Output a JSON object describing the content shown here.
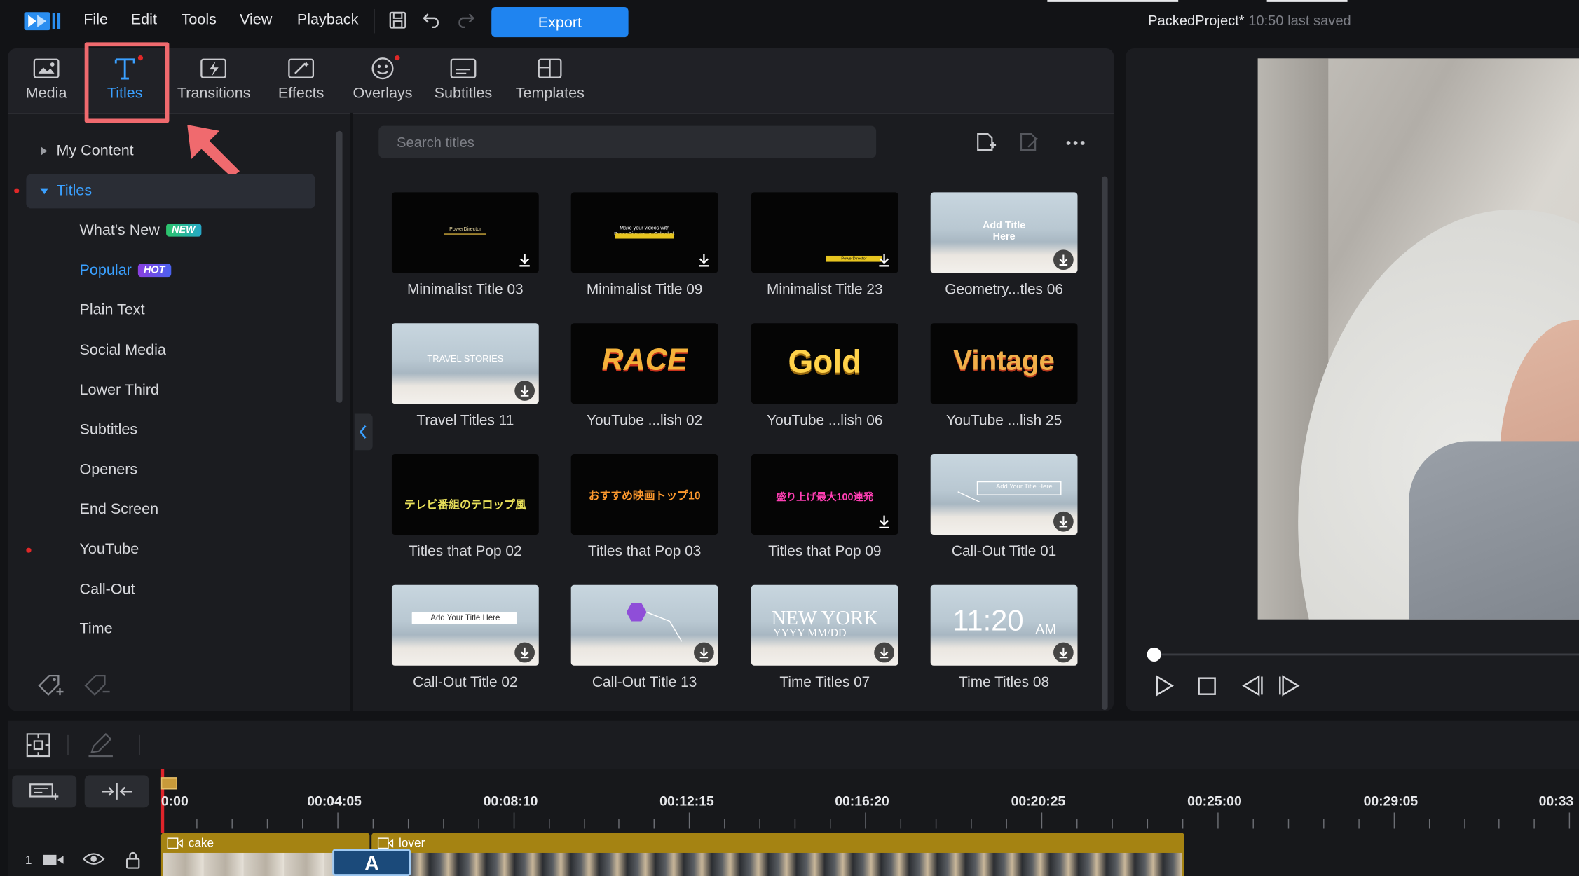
{
  "menu": {
    "file": "File",
    "edit": "Edit",
    "tools": "Tools",
    "view": "View",
    "playback": "Playback",
    "export": "Export"
  },
  "project": {
    "name": "PackedProject*",
    "saved": "10:50 last saved"
  },
  "tabs": [
    {
      "label": "Media",
      "icon": "media-icon"
    },
    {
      "label": "Titles",
      "icon": "titles-icon",
      "active": true
    },
    {
      "label": "Transitions",
      "icon": "transitions-icon"
    },
    {
      "label": "Effects",
      "icon": "effects-icon"
    },
    {
      "label": "Overlays",
      "icon": "overlays-icon"
    },
    {
      "label": "Subtitles",
      "icon": "subtitles-icon"
    },
    {
      "label": "Templates",
      "icon": "templates-icon"
    }
  ],
  "sidebar": {
    "my_content": "My Content",
    "titles": "Titles",
    "items": [
      {
        "label": "What's New",
        "badge": "NEW"
      },
      {
        "label": "Popular",
        "badge": "HOT"
      },
      {
        "label": "Plain Text"
      },
      {
        "label": "Social Media"
      },
      {
        "label": "Lower Third"
      },
      {
        "label": "Subtitles"
      },
      {
        "label": "Openers"
      },
      {
        "label": "End Screen"
      },
      {
        "label": "YouTube"
      },
      {
        "label": "Call-Out"
      },
      {
        "label": "Time"
      }
    ]
  },
  "search": {
    "placeholder": "Search titles"
  },
  "tiles": [
    {
      "label": "Minimalist Title 03",
      "thumb_text": "PowerDirector"
    },
    {
      "label": "Minimalist Title 09",
      "thumb_text": "Make your videos with PowerDirector by Cyberlink"
    },
    {
      "label": "Minimalist Title 23",
      "thumb_text": "PowerDirector"
    },
    {
      "label": "Geometry...tles 06",
      "thumb_text": "Add Title Here"
    },
    {
      "label": "Travel Titles 11",
      "thumb_text": "TRAVEL STORIES"
    },
    {
      "label": "YouTube ...lish 02",
      "thumb_text": "RACE"
    },
    {
      "label": "YouTube ...lish 06",
      "thumb_text": "Gold"
    },
    {
      "label": "YouTube ...lish 25",
      "thumb_text": "Vintage"
    },
    {
      "label": "Titles that Pop 02",
      "thumb_text": "テレビ番組のテロップ風"
    },
    {
      "label": "Titles that Pop 03",
      "thumb_text": "おすすめ映画トップ10"
    },
    {
      "label": "Titles that Pop 09",
      "thumb_text": "盛り上げ最大100連発"
    },
    {
      "label": "Call-Out Title 01",
      "thumb_text": "Add Your Title Here"
    },
    {
      "label": "Call-Out Title 02",
      "thumb_text": "Add Your Title Here"
    },
    {
      "label": "Call-Out Title 13",
      "thumb_text": ""
    },
    {
      "label": "Time Titles 07",
      "thumb_text": "NEW YORK",
      "thumb_sub": "YYYY MM/DD"
    },
    {
      "label": "Time Titles 08",
      "thumb_text": "11:20",
      "thumb_sub": "AM"
    }
  ],
  "timeline": {
    "times": [
      "0:00",
      "00:04:05",
      "00:08:10",
      "00:12:15",
      "00:16:20",
      "00:20:25",
      "00:25:00",
      "00:29:05",
      "00:33"
    ],
    "track_number": "1",
    "clips": [
      {
        "label": "cake"
      },
      {
        "label": "lover"
      }
    ],
    "title_clip_letter": "A"
  },
  "colors": {
    "accent": "#1f84f0",
    "highlight": "#f06a6e",
    "clip": "#a58312",
    "active_tab": "#3aa0ff"
  }
}
